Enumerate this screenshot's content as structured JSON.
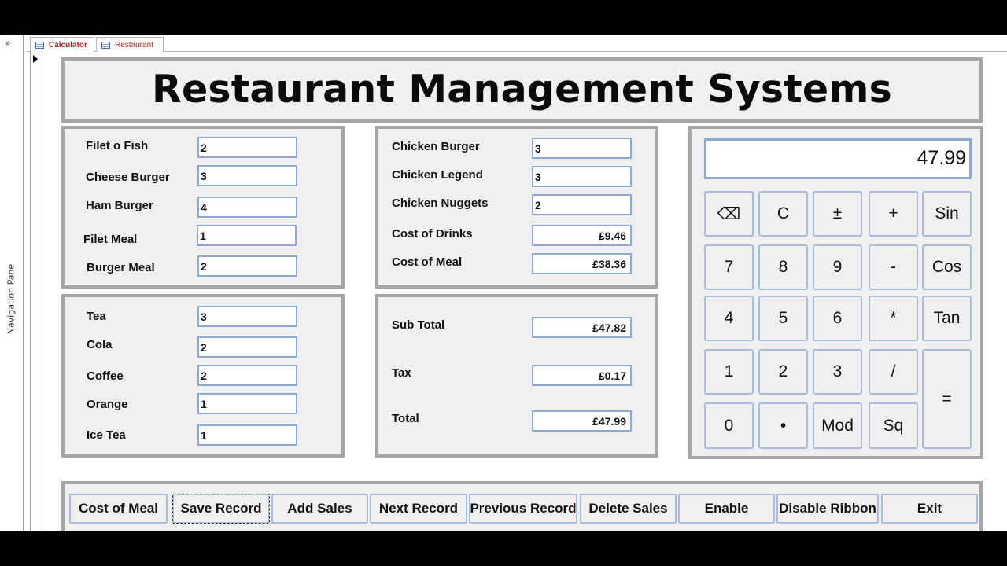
{
  "nav_pane": {
    "toggle": "»",
    "label": "Navigation Pane"
  },
  "tabs": [
    {
      "label": "Calculator",
      "active": true
    },
    {
      "label": "Restaurant",
      "active": false
    }
  ],
  "title": "Restaurant Management Systems",
  "food": [
    {
      "label": "Filet o Fish",
      "value": "2"
    },
    {
      "label": "Cheese Burger",
      "value": "3"
    },
    {
      "label": "Ham Burger",
      "value": "4"
    },
    {
      "label": "Filet Meal",
      "value": "1"
    },
    {
      "label": "Burger Meal",
      "value": "2"
    }
  ],
  "drinks": [
    {
      "label": "Tea",
      "value": "3"
    },
    {
      "label": "Cola",
      "value": "2"
    },
    {
      "label": "Coffee",
      "value": "2"
    },
    {
      "label": "Orange",
      "value": "1"
    },
    {
      "label": "Ice Tea",
      "value": "1"
    }
  ],
  "chicken": [
    {
      "label": "Chicken Burger",
      "value": "3"
    },
    {
      "label": "Chicken Legend",
      "value": "3"
    },
    {
      "label": "Chicken Nuggets",
      "value": "2"
    },
    {
      "label": "Cost of Drinks",
      "value": "£9.46"
    },
    {
      "label": "Cost of Meal",
      "value": "£38.36"
    }
  ],
  "totals": [
    {
      "label": "Sub Total",
      "value": "£47.82"
    },
    {
      "label": "Tax",
      "value": "£0.17"
    },
    {
      "label": "Total",
      "value": "£47.99"
    }
  ],
  "calculator": {
    "display": "47.99",
    "keys": [
      "⌫",
      "C",
      "±",
      "+",
      "Sin",
      "7",
      "8",
      "9",
      "-",
      "Cos",
      "4",
      "5",
      "6",
      "*",
      "Tan",
      "1",
      "2",
      "3",
      "/",
      "=",
      "0",
      "•",
      "Mod",
      "Sq"
    ]
  },
  "buttons": [
    "Cost of Meal",
    "Save Record",
    "Add Sales",
    "Next Record",
    "Previous Record",
    "Delete Sales",
    "Enable",
    "Disable Ribbon",
    "Exit"
  ]
}
